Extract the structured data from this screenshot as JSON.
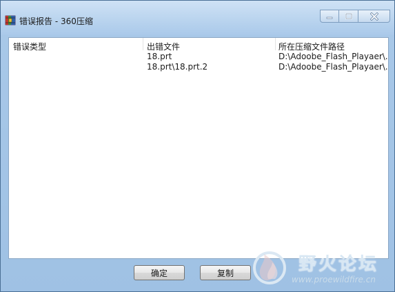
{
  "window": {
    "title": "错误报告 - 360压缩"
  },
  "table": {
    "columns": [
      "错误类型",
      "出错文件",
      "所在压缩文件路径"
    ],
    "rows": [
      {
        "type": "",
        "file": "18.prt",
        "path": "D:\\Adoobe_Flash_Playaer\\..."
      },
      {
        "type": "",
        "file": "18.prt\\18.prt.2",
        "path": "D:\\Adoobe_Flash_Playaer\\..."
      }
    ]
  },
  "buttons": {
    "ok": "确定",
    "copy": "复制"
  },
  "watermark": {
    "title": "野火论坛",
    "url": "www.proewildfire.cn"
  },
  "icons": {
    "app": "360-zip-app-icon",
    "minimize": "minimize-icon",
    "maximize": "maximize-icon",
    "close": "close-icon"
  }
}
